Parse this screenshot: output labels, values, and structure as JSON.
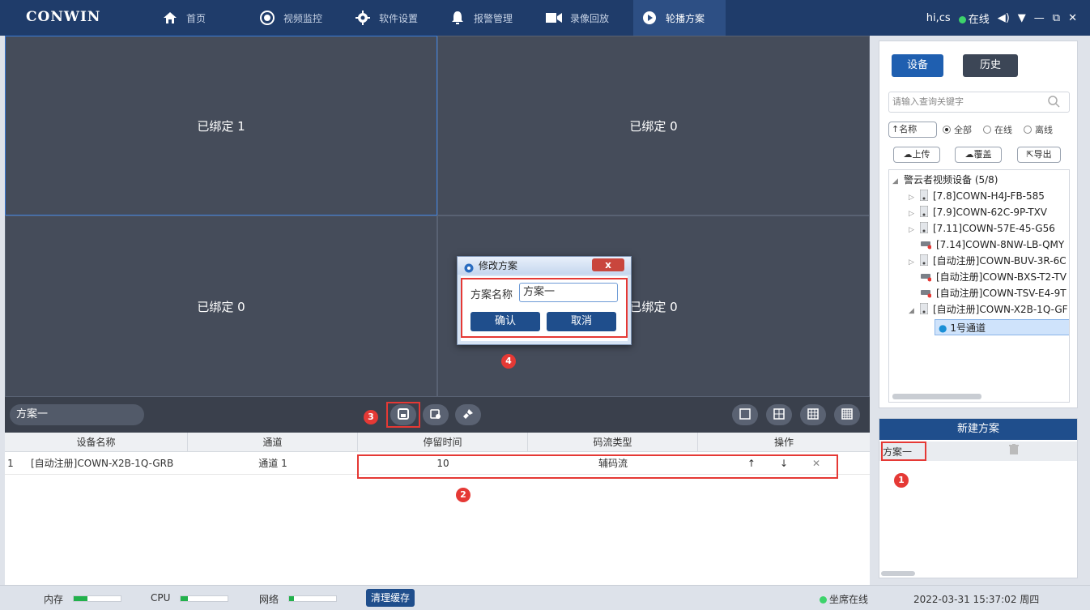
{
  "app": {
    "logo": "CONWIN",
    "nav": [
      {
        "label": "首页",
        "icon": "home-icon"
      },
      {
        "label": "视频监控",
        "icon": "record-icon"
      },
      {
        "label": "软件设置",
        "icon": "gear-icon"
      },
      {
        "label": "报警管理",
        "icon": "bell-icon"
      },
      {
        "label": "录像回放",
        "icon": "camera-icon"
      },
      {
        "label": "轮播方案",
        "icon": "play-icon"
      }
    ],
    "user": "hi,cs",
    "online_status": "在线",
    "window_controls": {
      "sound": "◀)",
      "dropdown": "▼",
      "minimize": "—",
      "restore": "⧉",
      "close": "✕"
    }
  },
  "video_grid": {
    "cells": [
      {
        "label": "已绑定 1"
      },
      {
        "label": "已绑定 0"
      },
      {
        "label": "已绑定 0"
      },
      {
        "label": "已绑定 0"
      }
    ]
  },
  "toolbar": {
    "scheme_name": "方案一",
    "badge_3": "3",
    "layout_icons": [
      "layout-1-icon",
      "layout-4-icon",
      "layout-9-icon",
      "layout-16-icon"
    ]
  },
  "table": {
    "columns": [
      "设备名称",
      "通道",
      "停留时间",
      "码流类型",
      "操作"
    ],
    "rows": [
      {
        "index": "1",
        "device": "[自动注册]COWN-X2B-1Q-GRB",
        "channel": "通道 1",
        "dwell": "10",
        "stream": "辅码流",
        "ops": [
          "↑",
          "↓",
          "✕"
        ]
      }
    ],
    "badge_2": "2"
  },
  "right_panel": {
    "tab_device": "设备",
    "tab_history": "历史",
    "search_placeholder": "请输入查询关键字",
    "sort_label": "↑名称",
    "filters": [
      "全部",
      "在线",
      "离线"
    ],
    "upload": "上传",
    "overwrite": "覆盖",
    "export": "导出",
    "tree": {
      "root": "警云者视频设备 (5/8)",
      "items": [
        "[7.8]COWN-H4J-FB-585",
        "[7.9]COWN-62C-9P-TXV",
        "[7.11]COWN-57E-45-G56",
        "[7.14]COWN-8NW-LB-QMY",
        "[自动注册]COWN-BUV-3R-6C",
        "[自动注册]COWN-BXS-T2-TV",
        "[自动注册]COWN-TSV-E4-9T",
        "[自动注册]COWN-X2B-1Q-GF"
      ],
      "channel": "1号通道"
    }
  },
  "scheme_panel": {
    "new_button": "新建方案",
    "items": [
      {
        "name": "方案一"
      }
    ],
    "badge_1": "1"
  },
  "dialog": {
    "title": "修改方案",
    "label": "方案名称",
    "value": "方案一",
    "confirm": "确认",
    "cancel": "取消",
    "close": "x",
    "badge_4": "4"
  },
  "status": {
    "memory": "内存",
    "memory_level": 0.3,
    "cpu": "CPU",
    "cpu_level": 0.15,
    "network": "网络",
    "network_level": 0.1,
    "clear_cache": "清理缓存",
    "seat_online": "坐席在线",
    "datetime": "2022-03-31 15:37:02 周四"
  }
}
